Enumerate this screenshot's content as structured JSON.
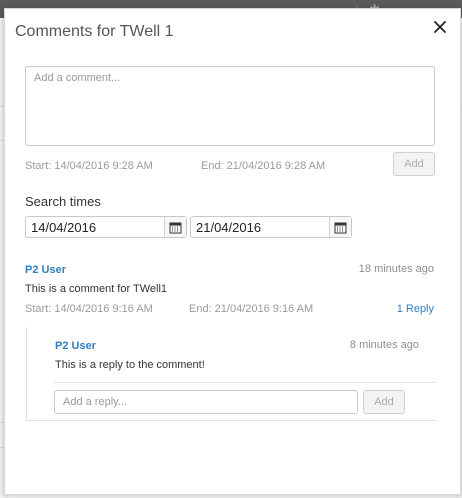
{
  "modal": {
    "title": "Comments for TWell 1"
  },
  "new_comment": {
    "placeholder": "Add a comment...",
    "start": "Start: 14/04/2016 9:28 AM",
    "end": "End: 21/04/2016 9:28 AM",
    "add_label": "Add"
  },
  "search": {
    "label": "Search times",
    "from": "14/04/2016",
    "to": "21/04/2016"
  },
  "comments": [
    {
      "author": "P2 User",
      "ago": "18 minutes ago",
      "text": "This is a comment for TWell1",
      "start": "Start: 14/04/2016 9:16 AM",
      "end": "End: 21/04/2016 9:16 AM",
      "replies_label": "1 Reply",
      "replies": [
        {
          "author": "P2 User",
          "ago": "8 minutes ago",
          "text": "This is a reply to the comment!"
        }
      ],
      "reply_placeholder": "Add a reply...",
      "reply_add_label": "Add"
    }
  ],
  "colors": {
    "link": "#2f7fbf",
    "muted": "#9a9a9a"
  },
  "icons": [
    "close-icon",
    "calendar-icon"
  ]
}
